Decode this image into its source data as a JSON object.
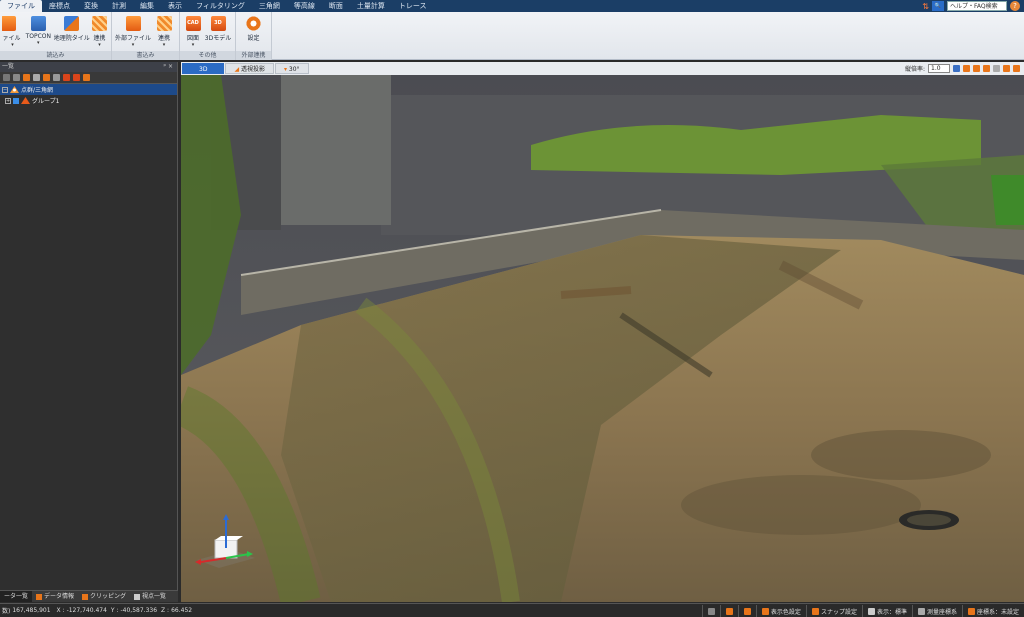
{
  "menu": {
    "items": [
      "ファイル",
      "座標点",
      "変換",
      "計測",
      "編集",
      "表示",
      "フィルタリング",
      "三角網",
      "等高線",
      "断面",
      "土量計算",
      "トレース"
    ],
    "active_index": 0
  },
  "help": {
    "search_text": "ヘルプ・FAQ検索"
  },
  "ribbon": {
    "groups": [
      {
        "title": "読込み",
        "buttons": [
          {
            "label": "ファイル",
            "icon": "open-file-icon"
          },
          {
            "label": "TOPCON",
            "icon": "topcon-icon"
          },
          {
            "label": "地理院タイル",
            "icon": "map-tile-icon"
          },
          {
            "label": "連携",
            "icon": "link-icon"
          }
        ]
      },
      {
        "title": "書込み",
        "buttons": [
          {
            "label": "外部ファイル",
            "icon": "export-file-icon"
          },
          {
            "label": "連携",
            "icon": "link-icon"
          }
        ]
      },
      {
        "title": "その他",
        "buttons": [
          {
            "label": "図面",
            "icon": "cad-icon",
            "icon_text": "CAD"
          },
          {
            "label": "3Dモデル",
            "icon": "3d-model-icon",
            "icon_text": "3D"
          }
        ]
      },
      {
        "title": "外部連携",
        "buttons": [
          {
            "label": "設定",
            "icon": "gear-icon"
          }
        ]
      }
    ]
  },
  "left_panel": {
    "title": "一覧",
    "tree": [
      {
        "label": "点群/三角網",
        "level": 0,
        "selected": true
      },
      {
        "label": "グループ1",
        "level": 1,
        "selected": false
      }
    ],
    "tabs": [
      "ータ一覧",
      "データ情報",
      "クリッピング",
      "視点一覧"
    ],
    "active_tab": 0
  },
  "viewport": {
    "tabs": [
      "3D",
      "透視投影",
      "30°"
    ],
    "active_tab": 0,
    "scale_label": "縦倍率:",
    "scale_value": "1.0"
  },
  "status": {
    "point_count_label": "数)",
    "point_count": "167,485,901",
    "x_label": "X :",
    "x": "-127,740.474",
    "y_label": "Y :",
    "y": "-40,587.336",
    "z_label": "Z :",
    "z": "66.452",
    "buttons": [
      "表示色設定",
      "スナップ設定",
      "表示：標準",
      "測量座標系",
      "座標系：未設定"
    ]
  },
  "colors": {
    "menubar": "#1b3e66",
    "accent": "#2b6bc4",
    "orange_icon": "#e8751a",
    "ground": "#8a7550",
    "vegetation": "#7aa83a"
  }
}
